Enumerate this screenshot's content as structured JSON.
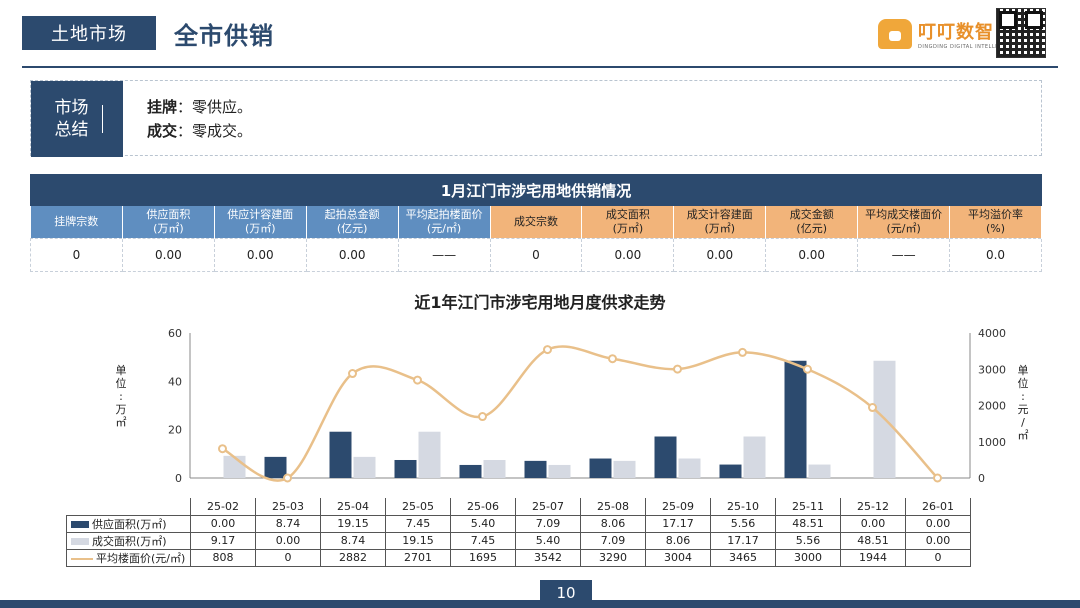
{
  "header": {
    "tag": "土地市场",
    "title": "全市供销"
  },
  "logo": {
    "name": "叮叮数智",
    "subtitle": "DINGDING DIGITAL INTELLIGENCE"
  },
  "summary": {
    "tag_line1": "市场",
    "tag_line2": "总结",
    "items": [
      {
        "label": "挂牌",
        "text": "：零供应。"
      },
      {
        "label": "成交",
        "text": "：零成交。"
      }
    ]
  },
  "supply_table": {
    "title": "1月江门市涉宅用地供销情况",
    "headers": [
      [
        "挂牌宗数",
        ""
      ],
      [
        "供应面积",
        "(万㎡)"
      ],
      [
        "供应计容建面",
        "(万㎡)"
      ],
      [
        "起拍总金额",
        "(亿元)"
      ],
      [
        "平均起拍楼面价",
        "(元/㎡)"
      ],
      [
        "成交宗数",
        ""
      ],
      [
        "成交面积",
        "(万㎡)"
      ],
      [
        "成交计容建面",
        "(万㎡)"
      ],
      [
        "成交金额",
        "(亿元)"
      ],
      [
        "平均成交楼面价",
        "(元/㎡)"
      ],
      [
        "平均溢价率",
        "(%)"
      ]
    ],
    "values": [
      "0",
      "0.00",
      "0.00",
      "0.00",
      "——",
      "0",
      "0.00",
      "0.00",
      "0.00",
      "——",
      "0.0"
    ]
  },
  "chart_data": {
    "type": "bar",
    "title": "近1年江门市涉宅用地月度供求走势",
    "categories": [
      "25-02",
      "25-03",
      "25-04",
      "25-05",
      "25-06",
      "25-07",
      "25-08",
      "25-09",
      "25-10",
      "25-11",
      "25-12",
      "26-01"
    ],
    "ylabel_left": "单位：万㎡",
    "ylabel_right": "单位：元/㎡",
    "ylim_left": [
      0,
      60
    ],
    "ylim_right": [
      0,
      4000
    ],
    "yticks_left": [
      "0",
      "20",
      "40",
      "60"
    ],
    "yticks_right": [
      "0",
      "1000",
      "2000",
      "3000",
      "4000"
    ],
    "series": [
      {
        "name": "供应面积(万㎡)",
        "type": "bar",
        "color": "#2c4a6e",
        "values": [
          0.0,
          8.74,
          19.15,
          7.45,
          5.4,
          7.09,
          8.06,
          17.17,
          5.56,
          48.51,
          0.0,
          0.0
        ],
        "labels": [
          "0.00",
          "8.74",
          "19.15",
          "7.45",
          "5.40",
          "7.09",
          "8.06",
          "17.17",
          "5.56",
          "48.51",
          "0.00",
          "0.00"
        ]
      },
      {
        "name": "成交面积(万㎡)",
        "type": "bar",
        "color": "#d5d9e2",
        "values": [
          9.17,
          0.0,
          8.74,
          19.15,
          7.45,
          5.4,
          7.09,
          8.06,
          17.17,
          5.56,
          48.51,
          0.0
        ],
        "labels": [
          "9.17",
          "0.00",
          "8.74",
          "19.15",
          "7.45",
          "5.40",
          "7.09",
          "8.06",
          "17.17",
          "5.56",
          "48.51",
          "0.00"
        ]
      },
      {
        "name": "平均楼面价(元/㎡)",
        "type": "line",
        "axis": "right",
        "color": "#e9c08a",
        "values": [
          808,
          0,
          2882,
          2701,
          1695,
          3542,
          3290,
          3004,
          3465,
          3000,
          1944,
          0
        ],
        "labels": [
          "808",
          "0",
          "2882",
          "2701",
          "1695",
          "3542",
          "3290",
          "3004",
          "3465",
          "3000",
          "1944",
          "0"
        ]
      }
    ]
  },
  "page_number": "10"
}
